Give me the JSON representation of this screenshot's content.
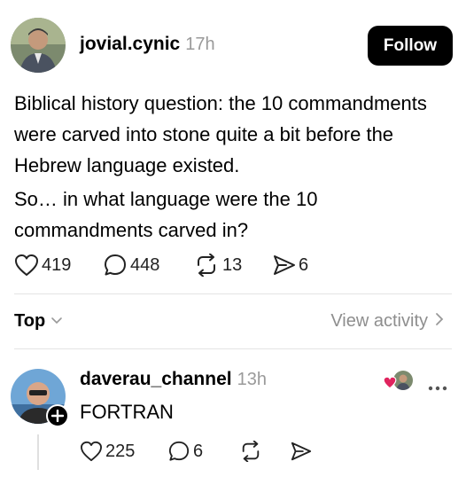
{
  "post": {
    "username": "jovial.cynic",
    "time": "17h",
    "follow_label": "Follow",
    "paragraph1": "Biblical history question: the 10 commandments were carved into stone quite a bit before the Hebrew language existed.",
    "paragraph2": "So… in what language were the 10 commandments carved in?",
    "likes": "419",
    "comments": "448",
    "reposts": "13",
    "shares": "6"
  },
  "filter": {
    "sort_label": "Top",
    "view_activity": "View activity"
  },
  "reply": {
    "username": "daverau_channel",
    "time": "13h",
    "text": "FORTRAN",
    "likes": "225",
    "comments": "6"
  },
  "colors": {
    "follow_bg": "#000000",
    "liked_heart": "#e0245e",
    "muted_text": "#8e8e8e"
  },
  "icons": [
    "heart-icon",
    "comment-icon",
    "repost-icon",
    "share-icon",
    "chevron-down-icon",
    "chevron-right-icon",
    "more-icon",
    "plus-icon"
  ]
}
